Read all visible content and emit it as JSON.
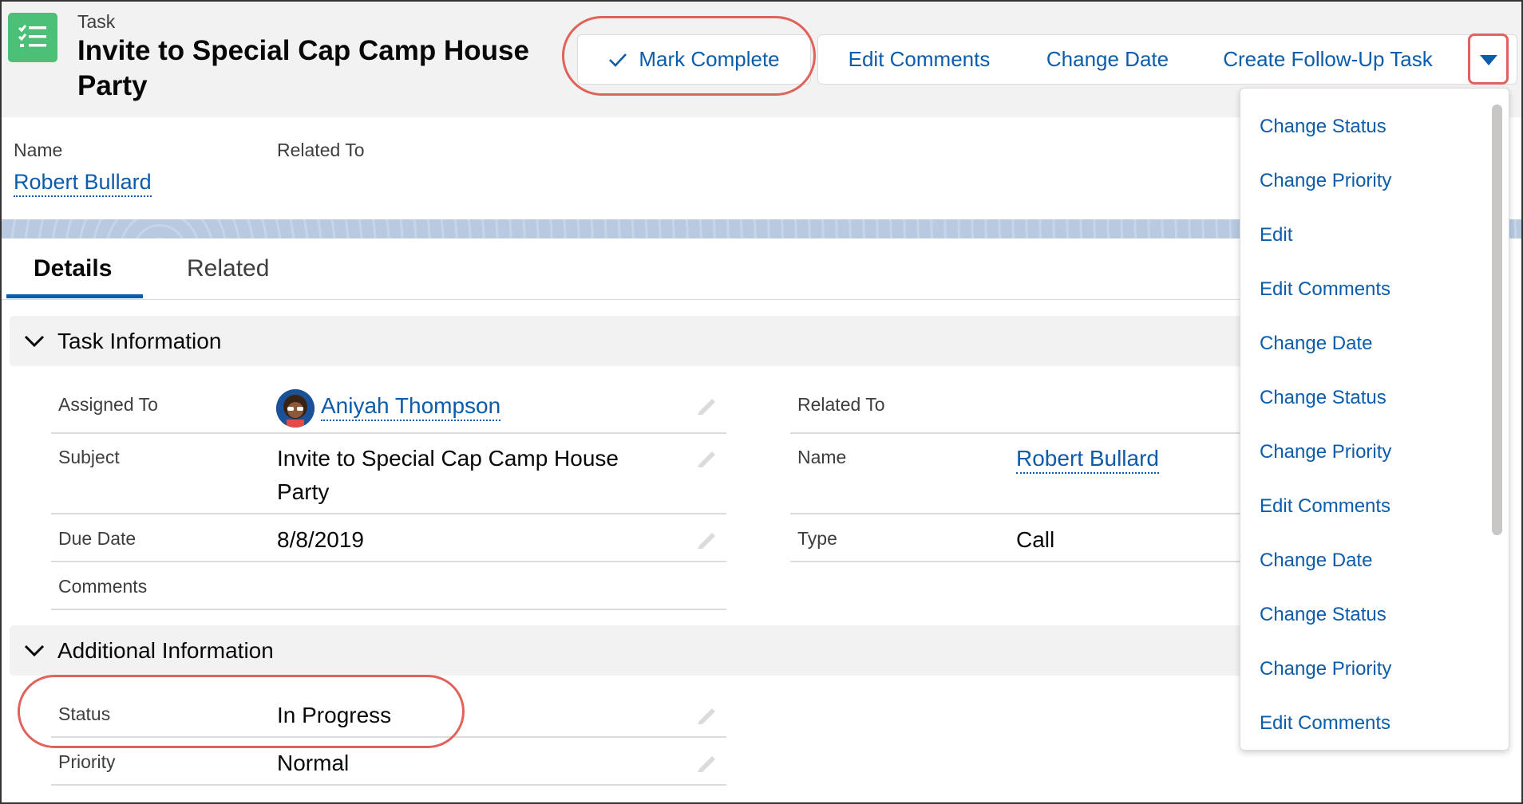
{
  "header": {
    "object_type": "Task",
    "title": "Invite to Special Cap Camp House Party",
    "actions": {
      "mark_complete": "Mark Complete",
      "edit_comments": "Edit Comments",
      "change_date": "Change Date",
      "create_follow_up": "Create Follow-Up Task"
    }
  },
  "highlights": {
    "name_label": "Name",
    "name_value": "Robert Bullard",
    "related_to_label": "Related To"
  },
  "tabs": [
    {
      "label": "Details",
      "active": true
    },
    {
      "label": "Related",
      "active": false
    }
  ],
  "task_information": {
    "title": "Task Information",
    "assigned_to_label": "Assigned To",
    "assigned_to_value": "Aniyah Thompson",
    "subject_label": "Subject",
    "subject_value": "Invite to Special Cap Camp House Party",
    "due_date_label": "Due Date",
    "due_date_value": "8/8/2019",
    "comments_label": "Comments",
    "related_to_label": "Related To",
    "name_label": "Name",
    "name_value": "Robert Bullard",
    "type_label": "Type",
    "type_value": "Call"
  },
  "additional_information": {
    "title": "Additional Information",
    "status_label": "Status",
    "status_value": "In Progress",
    "priority_label": "Priority",
    "priority_value": "Normal"
  },
  "menu": {
    "items": [
      "Change Status",
      "Change Priority",
      "Edit",
      "Edit Comments",
      "Change Date",
      "Change Status",
      "Change Priority",
      "Edit Comments",
      "Change Date",
      "Change Status",
      "Change Priority",
      "Edit Comments"
    ]
  },
  "colors": {
    "link": "#0b5cab",
    "task_icon": "#4bc076",
    "callout": "#e0625a",
    "header_bg": "#f3f2f2"
  },
  "icons": {
    "task": "task-list-icon",
    "check": "check-icon",
    "menu": "chevron-down-icon",
    "section": "chevron-down-icon",
    "edit": "pencil-icon"
  }
}
